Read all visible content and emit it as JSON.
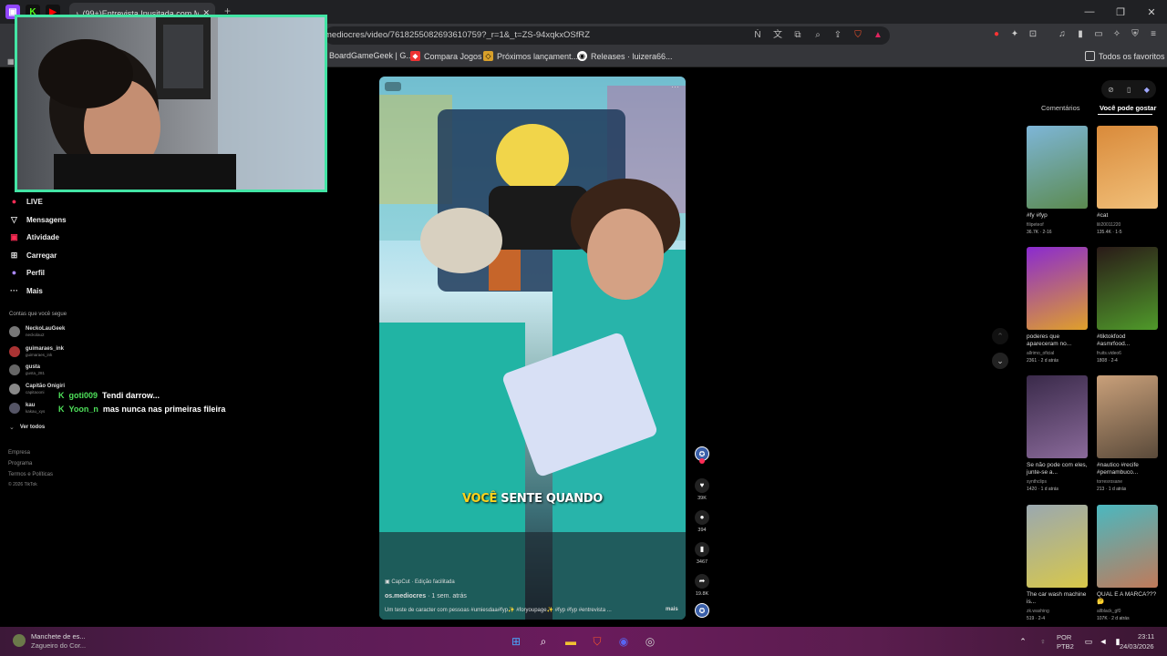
{
  "browser": {
    "tab_title": "(99+)Entrevista Inusitada com M",
    "url": "mediocres/video/7618255082693610759?_r=1&_t=ZS-94xqkxOSfRZ",
    "bookmarks": [
      "BoardGameGeek | G...",
      "Compara Jogos",
      "Próximos lançament...",
      "Releases · luizera66..."
    ],
    "all_favorites": "Todos os favoritos"
  },
  "nav": {
    "items": [
      {
        "icon": "live-icon",
        "label": "LIVE"
      },
      {
        "icon": "messages-icon",
        "label": "Mensagens"
      },
      {
        "icon": "activity-icon",
        "label": "Atividade"
      },
      {
        "icon": "upload-icon",
        "label": "Carregar"
      },
      {
        "icon": "profile-icon",
        "label": "Perfil"
      },
      {
        "icon": "more-icon",
        "label": "Mais"
      }
    ],
    "following_header": "Contas que você segue",
    "accounts": [
      {
        "name": "NeckoLauGeek",
        "handle": "neckolau2"
      },
      {
        "name": "guimaraes_ink",
        "handle": "guimaraes_ink"
      },
      {
        "name": "gusta",
        "handle": "gusta_281"
      },
      {
        "name": "Capitão Onigiri",
        "handle": "capitaooni"
      },
      {
        "name": "kau",
        "handle": "kakau_xys"
      }
    ],
    "see_all": "Ver todos",
    "footer": [
      "Empresa",
      "Programa",
      "Termos e Políticas",
      "© 2026 TikTok"
    ]
  },
  "chat": [
    {
      "user": "goti009",
      "message": "Tendi darrow..."
    },
    {
      "user": "Yoon_n",
      "message": "mas nunca nas primeiras fileira"
    }
  ],
  "video": {
    "caption_highlight": "VOCÊ",
    "caption_rest": " SENTE QUANDO",
    "capcut_tag": "CapCut · Edição facilitada",
    "author": "os.mediocres",
    "meta": "· 1 sem. atrás",
    "description": "Um teste de caracter com pessoas #umiesdaa#fyp✨ #foryoupage✨ #fyp #fyp #entrevista ...",
    "more": "mais",
    "likes": "39K",
    "comments": "394",
    "saves": "3467",
    "shares": "19.8K"
  },
  "right_panel": {
    "tab_comments": "Comentários",
    "tab_suggested": "Você pode gostar",
    "items": [
      {
        "title": "#fy #fyp",
        "user": "filipeteof",
        "stat": "36.7K · 2-16",
        "colors": [
          "#7eb6d8",
          "#5b8a4f"
        ]
      },
      {
        "title": "#cat",
        "user": "lili20011220",
        "stat": "135.4K · 1-5",
        "colors": [
          "#d98a3a",
          "#f1c07a"
        ]
      },
      {
        "title": "poderes que apareceram no...",
        "user": "allrimo_oficial",
        "stat": "2361 · 2 d atrás",
        "colors": [
          "#8a2ad0",
          "#e0a02a"
        ]
      },
      {
        "title": "#tiktokfood #asmrfood...",
        "user": "fruits.video6",
        "stat": "1808 · 2-4",
        "colors": [
          "#2a1a18",
          "#4f9a2a"
        ]
      },
      {
        "title": "Se não pode com eles, junte-se a...",
        "user": "synthclips",
        "stat": "1420 · 1 d atrás",
        "colors": [
          "#3a2a4a",
          "#8a6a9a"
        ]
      },
      {
        "title": "#nautico #recife #pernambuco...",
        "user": "torresrosane",
        "stat": "213 · 1 d atrás",
        "colors": [
          "#c9a07a",
          "#5a4a3a"
        ]
      },
      {
        "title": "The car wash machine is...",
        "user": "zk.washing",
        "stat": "519 · 2-4",
        "colors": [
          "#9aa8b0",
          "#d8c84a"
        ]
      },
      {
        "title": "QUAL E A MARCA??? 🤔",
        "user": "allblack_gf0",
        "stat": "107K · 2 d atrás",
        "colors": [
          "#4ab8c0",
          "#c07a5a"
        ]
      }
    ]
  },
  "taskbar": {
    "news_title": "Manchete de es...",
    "news_sub": "Zagueiro do Cor...",
    "lang": "POR",
    "layout": "PTB2",
    "time": "23:11",
    "date": "24/03/2026"
  },
  "colors": {
    "webcam_border": "#43e5a5",
    "chat_user": "#4ee05a",
    "caption_highlight": "#ffd21c",
    "taskbar": "#5a1d55"
  }
}
